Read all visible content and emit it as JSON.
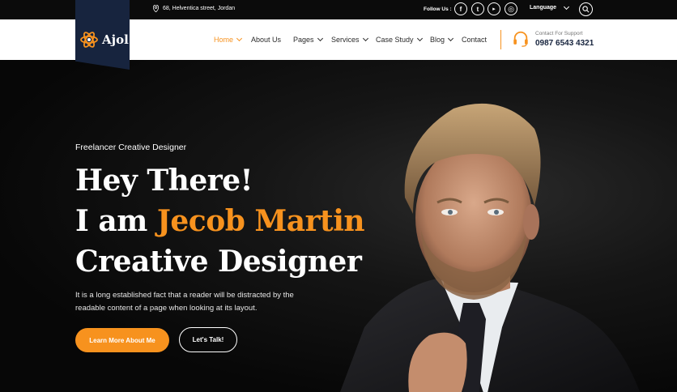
{
  "topbar": {
    "address": "68, Helventica street, Jordan",
    "follow_label": "Follow Us :",
    "social": [
      {
        "icon": "facebook-icon",
        "glyph": "f"
      },
      {
        "icon": "twitter-icon",
        "glyph": "t"
      },
      {
        "icon": "youtube-icon",
        "glyph": "▸"
      },
      {
        "icon": "instagram-icon",
        "glyph": "◎"
      }
    ],
    "language_label": "Language"
  },
  "brand": {
    "name": "Ajol"
  },
  "nav": {
    "items": [
      {
        "label": "Home",
        "has_dropdown": true,
        "active": true
      },
      {
        "label": "About Us",
        "has_dropdown": false
      },
      {
        "label": "Pages",
        "has_dropdown": true
      },
      {
        "label": "Services",
        "has_dropdown": true
      },
      {
        "label": "Case Study",
        "has_dropdown": true
      },
      {
        "label": "Blog",
        "has_dropdown": true
      },
      {
        "label": "Contact",
        "has_dropdown": false
      }
    ],
    "support_label": "Contact For Support",
    "support_phone": "0987 6543 4321"
  },
  "hero": {
    "eyebrow": "Freelancer Creative Designer",
    "line1": "Hey There!",
    "line2_prefix": "I am",
    "line2_name": "Jecob Martin",
    "line3": "Creative Designer",
    "description": "It is a long established fact that a reader will be distracted by the readable content of a page when looking at its layout.",
    "primary_button": "Learn More About Me",
    "secondary_button": "Let's Talk!"
  },
  "colors": {
    "accent": "#f7921e",
    "navy": "#17243e",
    "background": "#0b0b0b"
  }
}
